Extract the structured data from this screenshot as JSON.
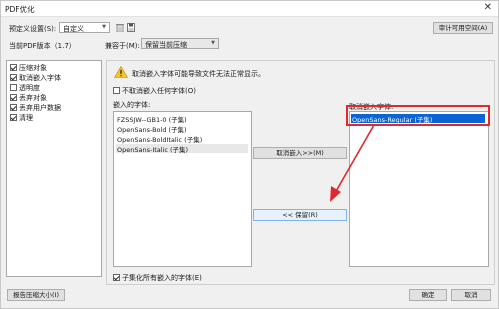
{
  "window": {
    "title": "PDF优化",
    "close_glyph": "✕"
  },
  "preset": {
    "label": "预定义设置(S):",
    "value": "自定义"
  },
  "version": {
    "label": "当前PDF版本（1.7）",
    "compat_label": "兼容于(M):",
    "compat_value": "保留当前压缩"
  },
  "audit_button": "审计可用空间(A)",
  "sidebar": {
    "items": [
      {
        "label": "压缩对象",
        "checked": true
      },
      {
        "label": "取消嵌入字体",
        "checked": true
      },
      {
        "label": "透明度",
        "checked": false
      },
      {
        "label": "丢弃对象",
        "checked": true
      },
      {
        "label": "丢弃用户数据",
        "checked": true
      },
      {
        "label": "清理",
        "checked": true
      }
    ]
  },
  "warning": {
    "icon": "warning-icon",
    "text": "取消嵌入字体可能导致文件无法正常显示。"
  },
  "no_unembed": {
    "label": "不取消嵌入任何字体(O)",
    "checked": false
  },
  "embedded_fonts": {
    "label": "嵌入的字体:",
    "items": [
      "FZSSJW--GB1-0 (子集)",
      "OpenSans-Bold (子集)",
      "OpenSans-BoldItalic (子集)",
      "OpenSans-Italic (子集)"
    ]
  },
  "unembed_fonts": {
    "label": "取消嵌入字体:",
    "items": [
      "OpenSans-Regular (子集)"
    ]
  },
  "unembed_button": "取消嵌入>>(M)",
  "keep_button": "<< 保留(R)",
  "subset_all": {
    "label": "子集化所有嵌入的字体(E)",
    "checked": true
  },
  "footer": {
    "report_button": "报告压缩大小(I)",
    "ok_button": "确定",
    "cancel_button": "取消"
  },
  "colors": {
    "accent": "#0a64d2",
    "annotation": "#e0282d"
  }
}
